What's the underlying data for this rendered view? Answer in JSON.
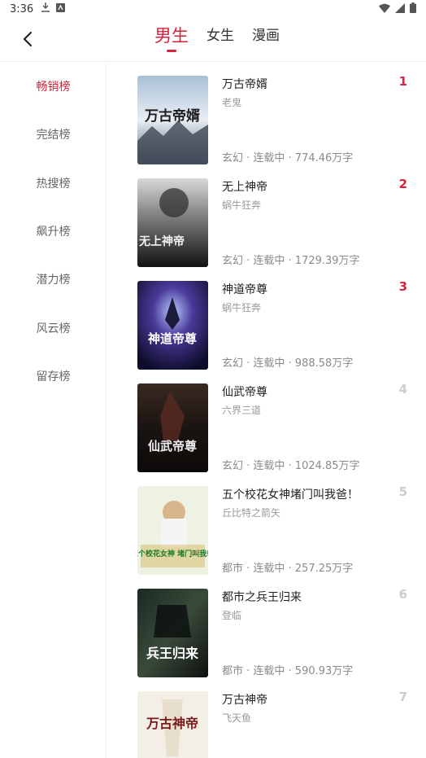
{
  "status_bar": {
    "time": "3:36"
  },
  "header": {
    "tabs": [
      {
        "label": "男生",
        "active": true
      },
      {
        "label": "女生",
        "active": false
      },
      {
        "label": "漫画",
        "active": false
      }
    ]
  },
  "sidebar": {
    "items": [
      {
        "label": "畅销榜",
        "active": true
      },
      {
        "label": "完结榜",
        "active": false
      },
      {
        "label": "热搜榜",
        "active": false
      },
      {
        "label": "飙升榜",
        "active": false
      },
      {
        "label": "潜力榜",
        "active": false
      },
      {
        "label": "风云榜",
        "active": false
      },
      {
        "label": "留存榜",
        "active": false
      }
    ]
  },
  "books": [
    {
      "rank": "1",
      "title": "万古帝婿",
      "author": "老鬼",
      "meta": "玄幻 · 连载中 · 774.46万字",
      "cover_text": "万古帝婿"
    },
    {
      "rank": "2",
      "title": "无上神帝",
      "author": "蜗牛狂奔",
      "meta": "玄幻 · 连载中 · 1729.39万字",
      "cover_text": "无上神帝"
    },
    {
      "rank": "3",
      "title": "神道帝尊",
      "author": "蜗牛狂奔",
      "meta": "玄幻 · 连载中 · 988.58万字",
      "cover_text": "神道帝尊"
    },
    {
      "rank": "4",
      "title": "仙武帝尊",
      "author": "六界三道",
      "meta": "玄幻 · 连载中 · 1024.85万字",
      "cover_text": "仙武帝尊"
    },
    {
      "rank": "5",
      "title": "五个校花女神堵门叫我爸！",
      "author": "丘比特之箭矢",
      "meta": "都市 · 连载中 · 257.25万字",
      "cover_text": "五个校花女神 堵门叫我爸"
    },
    {
      "rank": "6",
      "title": "都市之兵王归来",
      "author": "登临",
      "meta": "都市 · 连载中 · 590.93万字",
      "cover_text": "兵王归来"
    },
    {
      "rank": "7",
      "title": "万古神帝",
      "author": "飞天鱼",
      "meta": "",
      "cover_text": "万古神帝"
    }
  ]
}
